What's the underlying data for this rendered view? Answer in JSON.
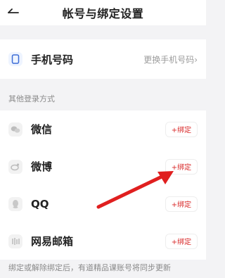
{
  "header": {
    "title": "帐号与绑定设置"
  },
  "phone": {
    "label": "手机号码",
    "action": "更换手机号码›"
  },
  "other_login": {
    "section_title": "其他登录方式",
    "items": [
      {
        "label": "微信",
        "button": "+绑定"
      },
      {
        "label": "微博",
        "button": "+绑定"
      },
      {
        "label": "QQ",
        "button": "+绑定"
      },
      {
        "label": "网易邮箱",
        "button": "+绑定"
      }
    ]
  },
  "footer": {
    "note": "绑定或解除绑定后，有道精品课账号将同步更新"
  },
  "colors": {
    "accent": "#d92a2a",
    "phone_icon": "#3b6bd6",
    "arrow": "#e01f1f"
  }
}
